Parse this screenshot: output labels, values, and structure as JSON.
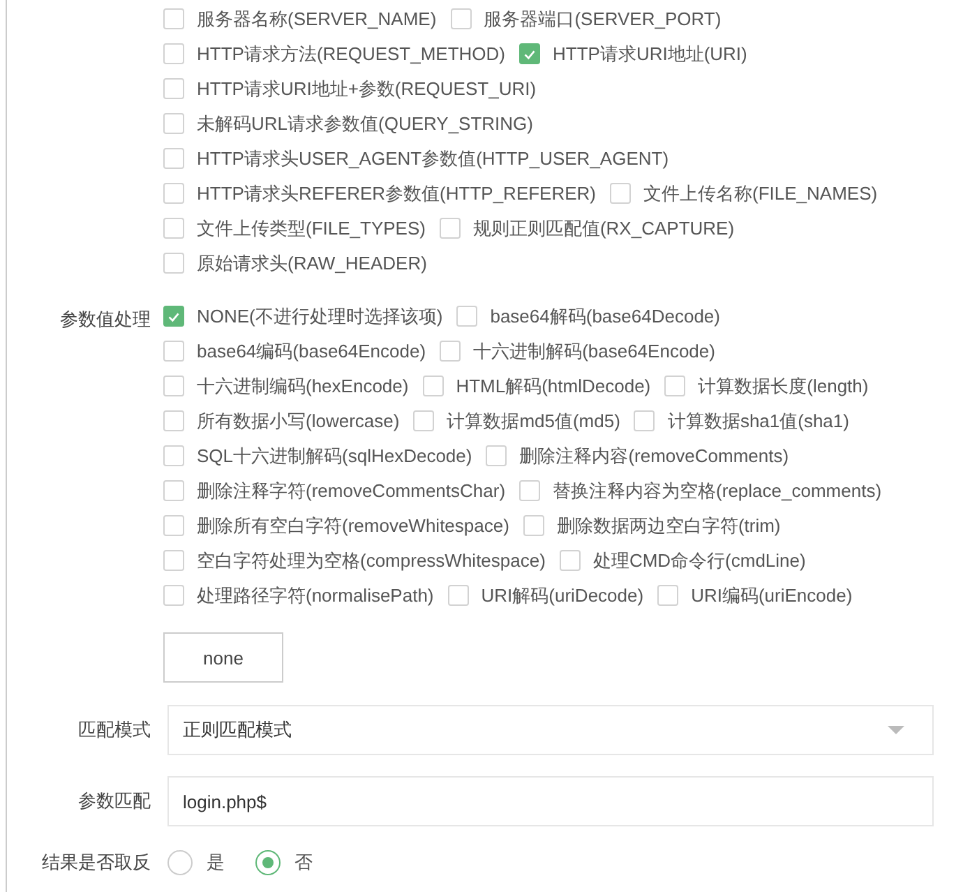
{
  "variable_rows": [
    [
      {
        "label": "服务器名称(SERVER_NAME)",
        "checked": false
      },
      {
        "label": "服务器端口(SERVER_PORT)",
        "checked": false
      }
    ],
    [
      {
        "label": "HTTP请求方法(REQUEST_METHOD)",
        "checked": false
      },
      {
        "label": "HTTP请求URI地址(URI)",
        "checked": true
      }
    ],
    [
      {
        "label": "HTTP请求URI地址+参数(REQUEST_URI)",
        "checked": false
      }
    ],
    [
      {
        "label": "未解码URL请求参数值(QUERY_STRING)",
        "checked": false
      }
    ],
    [
      {
        "label": "HTTP请求头USER_AGENT参数值(HTTP_USER_AGENT)",
        "checked": false
      }
    ],
    [
      {
        "label": "HTTP请求头REFERER参数值(HTTP_REFERER)",
        "checked": false
      },
      {
        "label": "文件上传名称(FILE_NAMES)",
        "checked": false
      }
    ],
    [
      {
        "label": "文件上传类型(FILE_TYPES)",
        "checked": false
      },
      {
        "label": "规则正则匹配值(RX_CAPTURE)",
        "checked": false
      }
    ],
    [
      {
        "label": "原始请求头(RAW_HEADER)",
        "checked": false
      }
    ]
  ],
  "processing": {
    "label": "参数值处理",
    "rows": [
      [
        {
          "label": "NONE(不进行处理时选择该项)",
          "checked": true
        },
        {
          "label": "base64解码(base64Decode)",
          "checked": false
        }
      ],
      [
        {
          "label": "base64编码(base64Encode)",
          "checked": false
        },
        {
          "label": "十六进制解码(base64Encode)",
          "checked": false
        }
      ],
      [
        {
          "label": "十六进制编码(hexEncode)",
          "checked": false
        },
        {
          "label": "HTML解码(htmlDecode)",
          "checked": false
        },
        {
          "label": "计算数据长度(length)",
          "checked": false
        }
      ],
      [
        {
          "label": "所有数据小写(lowercase)",
          "checked": false
        },
        {
          "label": "计算数据md5值(md5)",
          "checked": false
        },
        {
          "label": "计算数据sha1值(sha1)",
          "checked": false
        }
      ],
      [
        {
          "label": "SQL十六进制解码(sqlHexDecode)",
          "checked": false
        },
        {
          "label": "删除注释内容(removeComments)",
          "checked": false
        }
      ],
      [
        {
          "label": "删除注释字符(removeCommentsChar)",
          "checked": false
        },
        {
          "label": "替换注释内容为空格(replace_comments)",
          "checked": false
        }
      ],
      [
        {
          "label": "删除所有空白字符(removeWhitespace)",
          "checked": false
        },
        {
          "label": "删除数据两边空白字符(trim)",
          "checked": false
        }
      ],
      [
        {
          "label": "空白字符处理为空格(compressWhitespace)",
          "checked": false
        },
        {
          "label": "处理CMD命令行(cmdLine)",
          "checked": false
        }
      ],
      [
        {
          "label": "处理路径字符(normalisePath)",
          "checked": false
        },
        {
          "label": "URI解码(uriDecode)",
          "checked": false
        },
        {
          "label": "URI编码(uriEncode)",
          "checked": false
        }
      ]
    ],
    "tag": "none"
  },
  "match_mode": {
    "label": "匹配模式",
    "value": "正则匹配模式"
  },
  "param_match": {
    "label": "参数匹配",
    "value": "login.php$"
  },
  "invert": {
    "label": "结果是否取反",
    "options": [
      {
        "label": "是",
        "selected": false
      },
      {
        "label": "否",
        "selected": true
      }
    ]
  }
}
